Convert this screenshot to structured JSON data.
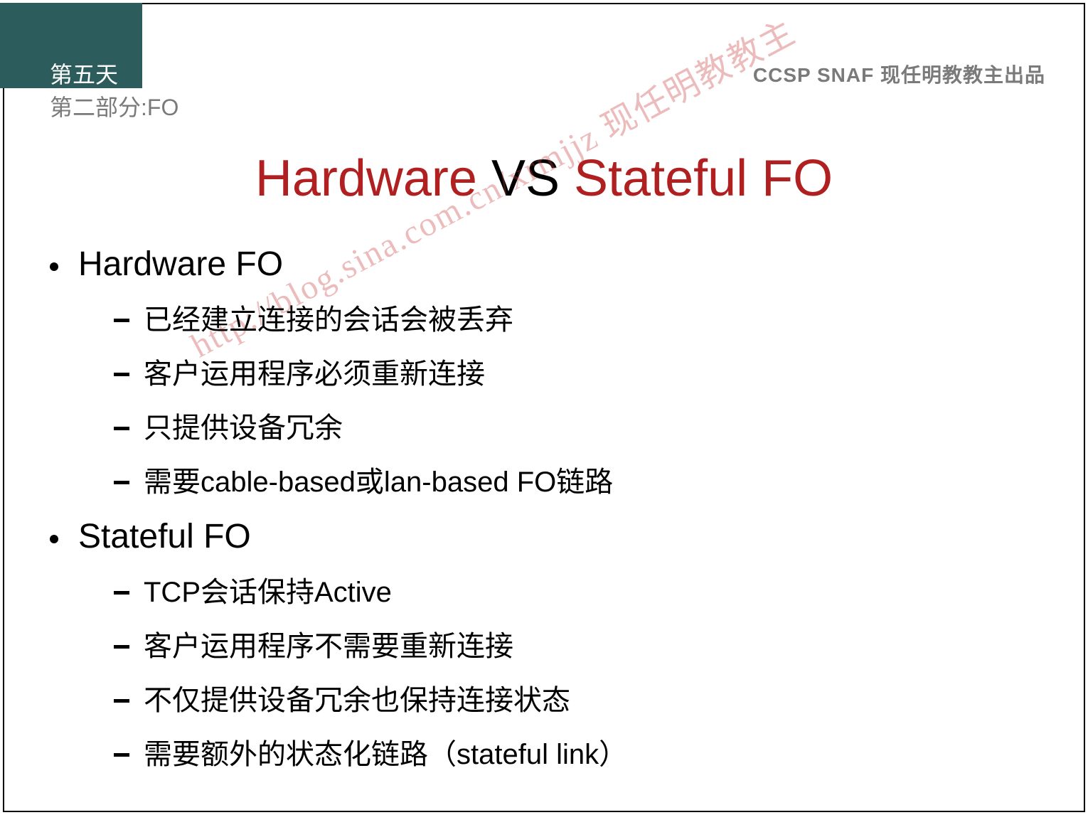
{
  "header": {
    "day": "第五天",
    "section": "第二部分:FO",
    "source": "CCSP SNAF  现任明教教主出品"
  },
  "title": {
    "part1": "Hardware",
    "part2": " VS ",
    "part3": "Stateful FO"
  },
  "bullets": [
    {
      "label": "Hardware FO",
      "items": [
        "已经建立连接的会话会被丢弃",
        "客户运用程序必须重新连接",
        "只提供设备冗余",
        "需要cable-based或lan-based FO链路"
      ]
    },
    {
      "label": "Stateful FO",
      "items": [
        "TCP会话保持Active",
        "客户运用程序不需要重新连接",
        "不仅提供设备冗余也保持连接状态",
        "需要额外的状态化链路（stateful link）"
      ]
    }
  ],
  "watermark": "http://blog.sina.com.cn/xrmjjz 现任明教教主"
}
